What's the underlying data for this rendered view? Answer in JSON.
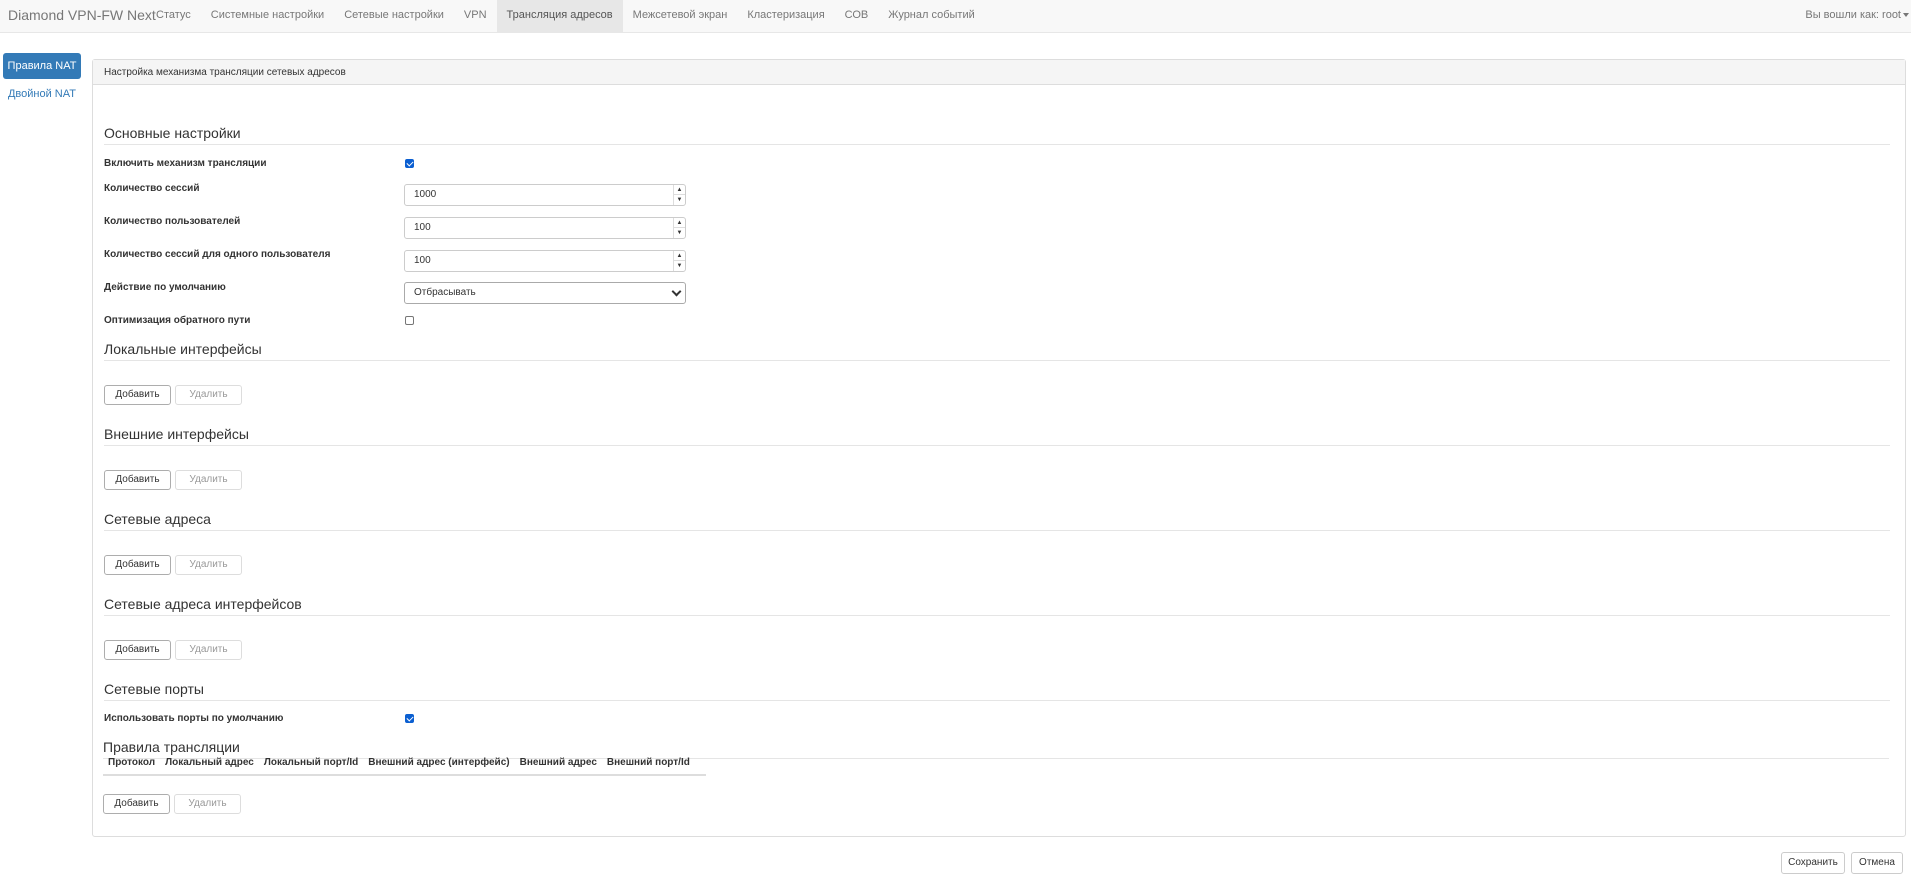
{
  "navbar": {
    "brand": "Diamond VPN-FW Next",
    "items": [
      {
        "label": "Статус",
        "active": false
      },
      {
        "label": "Системные настройки",
        "active": false
      },
      {
        "label": "Сетевые настройки",
        "active": false
      },
      {
        "label": "VPN",
        "active": false
      },
      {
        "label": "Трансляция адресов",
        "active": true
      },
      {
        "label": "Межсетевой экран",
        "active": false
      },
      {
        "label": "Кластеризация",
        "active": false
      },
      {
        "label": "СОВ",
        "active": false
      },
      {
        "label": "Журнал событий",
        "active": false
      }
    ],
    "user": "Вы вошли как: root"
  },
  "sidebar": {
    "items": [
      {
        "label": "Правила NAT",
        "active": true
      },
      {
        "label": "Двойной NAT",
        "active": false
      }
    ]
  },
  "panel": {
    "heading": "Настройка механизма трансляции сетевых адресов",
    "basic": {
      "title": "Основные настройки",
      "enable_label": "Включить механизм трансляции",
      "enable_checked": true,
      "sessions_label": "Количество сессий",
      "sessions_value": "1000",
      "users_label": "Количество пользователей",
      "users_value": "100",
      "sessions_per_user_label": "Количество сессий для одного пользователя",
      "sessions_per_user_value": "100",
      "default_action_label": "Действие по умолчанию",
      "default_action_value": "Отбрасывать",
      "reverse_path_label": "Оптимизация обратного пути",
      "reverse_path_checked": false
    },
    "local_interfaces": {
      "title": "Локальные интерфейсы"
    },
    "external_interfaces": {
      "title": "Внешние интерфейсы"
    },
    "network_addresses": {
      "title": "Сетевые адреса"
    },
    "interface_addresses": {
      "title": "Сетевые адреса интерфейсов"
    },
    "network_ports": {
      "title": "Сетевые порты",
      "default_ports_label": "Использовать порты по умолчанию",
      "default_ports_checked": true
    },
    "rules": {
      "title": "Правила трансляции",
      "columns": [
        "Протокол",
        "Локальный адрес",
        "Локальный порт/Id",
        "Внешний адрес (интерфейс)",
        "Внешний адрес",
        "Внешний порт/Id"
      ]
    },
    "buttons": {
      "add": "Добавить",
      "delete": "Удалить"
    }
  },
  "footer": {
    "save": "Сохранить",
    "cancel": "Отмена"
  }
}
